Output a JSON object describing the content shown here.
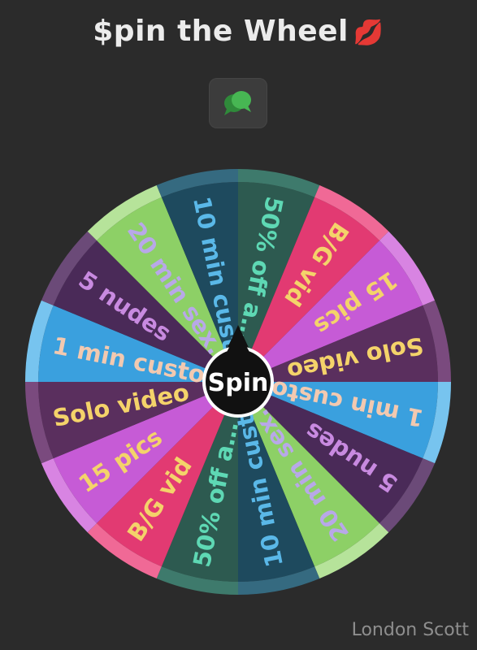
{
  "header": {
    "title": "$pin the Wheel",
    "title_emoji": "💋",
    "chat_icon": "speech-bubbles-icon",
    "chat_icon_color": "#3fa84a"
  },
  "wheel": {
    "segments": [
      {
        "label": "50% off a…",
        "color": "#2d5a50",
        "rim": "#3e7a6c",
        "text_color": "#5ed8b4"
      },
      {
        "label": "B/G vid",
        "color": "#e23a72",
        "rim": "#f06996",
        "text_color": "#f4d36a"
      },
      {
        "label": "15 pics",
        "color": "#c65bd6",
        "rim": "#d884e2",
        "text_color": "#f4d36a"
      },
      {
        "label": "Solo video",
        "color": "#5a2f5e",
        "rim": "#7a4a7e",
        "text_color": "#f4d36a"
      },
      {
        "label": "1 min custo…",
        "color": "#3aa0de",
        "rim": "#77c4ef",
        "text_color": "#f2c9b0"
      },
      {
        "label": "5 nudes",
        "color": "#4a2a58",
        "rim": "#6b4a78",
        "text_color": "#c88ae0"
      },
      {
        "label": "20 min sex…",
        "color": "#8dd066",
        "rim": "#b6e39a",
        "text_color": "#b8a8e8"
      },
      {
        "label": "10 min cust…",
        "color": "#1e4a5e",
        "rim": "#356a80",
        "text_color": "#5ab8e8"
      },
      {
        "label": "50% off a…",
        "color": "#2d5a50",
        "rim": "#3e7a6c",
        "text_color": "#5ed8b4"
      },
      {
        "label": "B/G vid",
        "color": "#e23a72",
        "rim": "#f06996",
        "text_color": "#f4d36a"
      },
      {
        "label": "15 pics",
        "color": "#c65bd6",
        "rim": "#d884e2",
        "text_color": "#f4d36a"
      },
      {
        "label": "Solo video",
        "color": "#5a2f5e",
        "rim": "#7a4a7e",
        "text_color": "#f4d36a"
      },
      {
        "label": "1 min custo…",
        "color": "#3aa0de",
        "rim": "#77c4ef",
        "text_color": "#f2c9b0"
      },
      {
        "label": "5 nudes",
        "color": "#4a2a58",
        "rim": "#6b4a78",
        "text_color": "#c88ae0"
      },
      {
        "label": "20 min sex…",
        "color": "#8dd066",
        "rim": "#b6e39a",
        "text_color": "#b8a8e8"
      },
      {
        "label": "10 min cust…",
        "color": "#1e4a5e",
        "rim": "#356a80",
        "text_color": "#5ab8e8"
      }
    ],
    "spin_label": "Spin"
  },
  "footer": {
    "credit": "London Scott"
  }
}
